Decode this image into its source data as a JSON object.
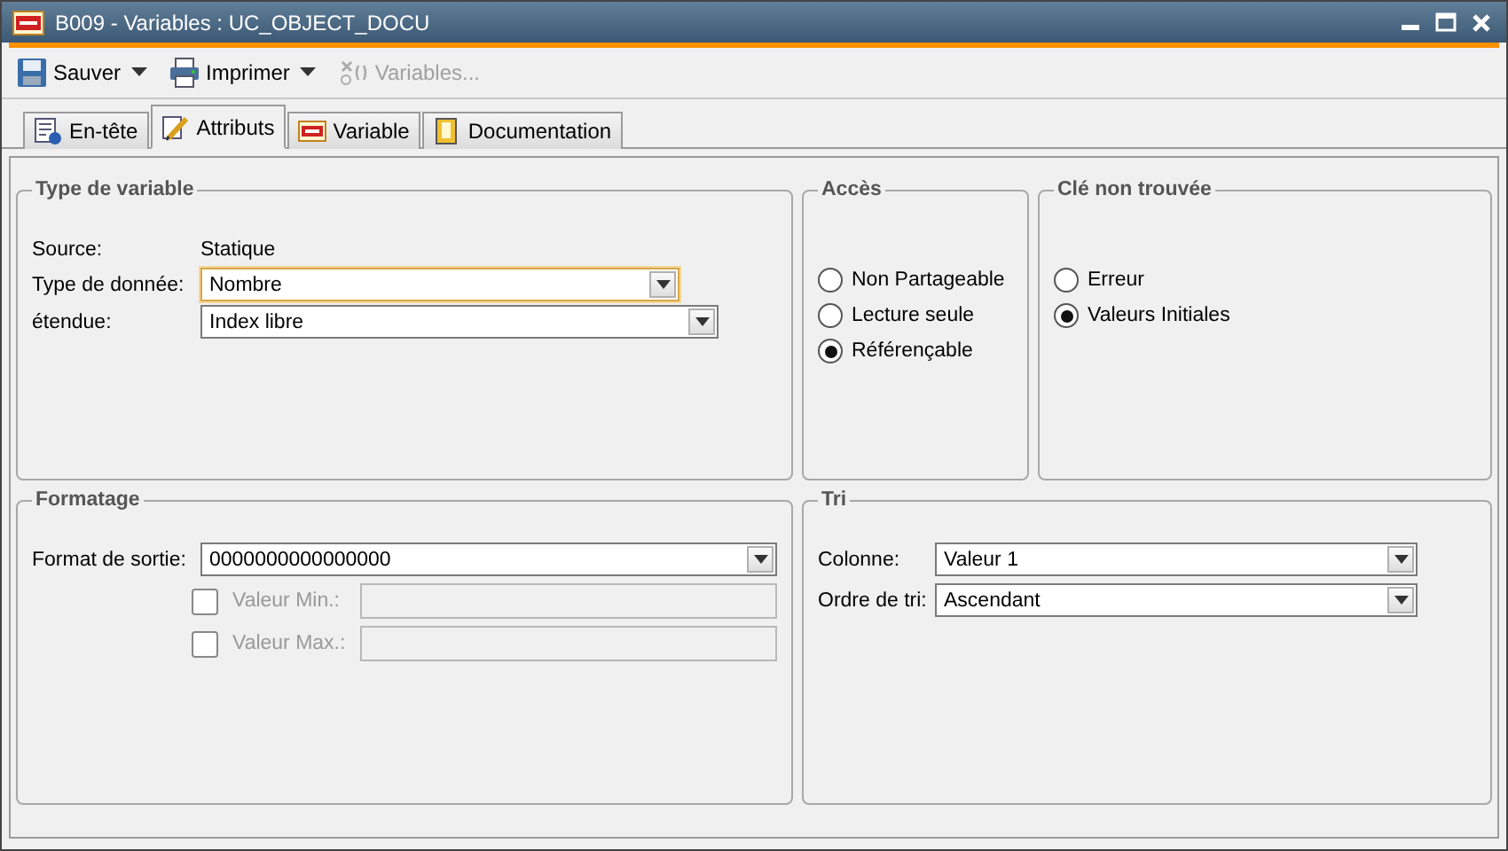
{
  "window": {
    "title": "B009 - Variables : UC_OBJECT_DOCU"
  },
  "toolbar": [
    {
      "label": "Sauver",
      "kind": "save",
      "dropdown": true,
      "disabled": false
    },
    {
      "label": "Imprimer",
      "kind": "print",
      "dropdown": true,
      "disabled": false
    },
    {
      "label": "Variables...",
      "kind": "variables",
      "dropdown": false,
      "disabled": true
    }
  ],
  "tabs": [
    {
      "label": "En-tête",
      "kind": "header",
      "selected": false
    },
    {
      "label": "Attributs",
      "kind": "attributes",
      "selected": true
    },
    {
      "label": "Variable",
      "kind": "variable",
      "selected": false
    },
    {
      "label": "Documentation",
      "kind": "documentation",
      "selected": false
    }
  ],
  "type_group": {
    "title": "Type de variable",
    "source_label": "Source:",
    "source_value": "Statique",
    "fields": [
      {
        "label": "Type de donnée:",
        "value": "Nombre",
        "focused": true
      },
      {
        "label": "étendue:",
        "value": "Index libre",
        "focused": false
      }
    ]
  },
  "access_group": {
    "title": "Accès",
    "options": [
      {
        "label": "Non Partageable",
        "selected": false
      },
      {
        "label": "Lecture seule",
        "selected": false
      },
      {
        "label": "Référençable",
        "selected": true
      }
    ]
  },
  "key_group": {
    "title": "Clé non trouvée",
    "options": [
      {
        "label": "Erreur",
        "selected": false
      },
      {
        "label": "Valeurs Initiales",
        "selected": true
      }
    ]
  },
  "format_group": {
    "title": "Formatage",
    "format_label": "Format de sortie:",
    "format_value": "0000000000000000",
    "ranges": [
      {
        "label": "Valeur Min.:",
        "checked": false,
        "disabled": true
      },
      {
        "label": "Valeur Max.:",
        "checked": false,
        "disabled": true
      }
    ]
  },
  "sort_group": {
    "title": "Tri",
    "fields": [
      {
        "label": "Colonne:",
        "value": "Valeur 1",
        "focused": false
      },
      {
        "label": "Ordre de tri:",
        "value": "Ascendant",
        "focused": false
      }
    ]
  }
}
